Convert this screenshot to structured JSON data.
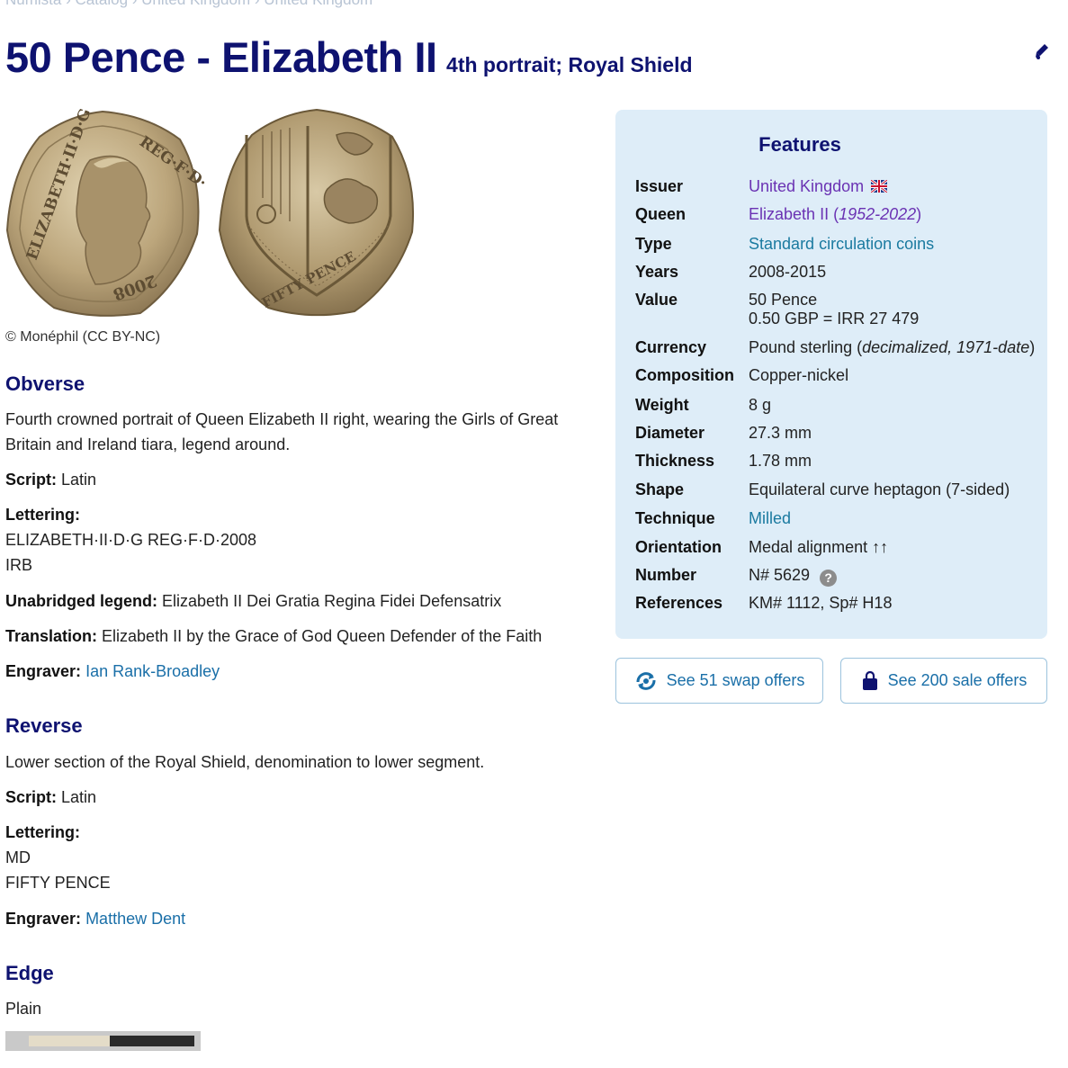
{
  "breadcrumb": "Numista › Catalog › United Kingdom › United Kingdom",
  "header": {
    "title": "50 Pence - Elizabeth II",
    "subtitle": "4th portrait; Royal Shield"
  },
  "coins": {
    "obverse_legend_left": "ELIZABETH·II·D·G",
    "obverse_legend_right": "REG·F·D·",
    "obverse_year": "2008",
    "reverse_legend": "FIFTY PENCE",
    "credit": "© Monéphil (CC BY-NC)"
  },
  "obverse": {
    "title": "Obverse",
    "description": "Fourth crowned portrait of Queen Elizabeth II right, wearing the Girls of Great Britain and Ireland tiara, legend around.",
    "script_label": "Script:",
    "script_value": "Latin",
    "lettering_label": "Lettering:",
    "lettering_line1": "ELIZABETH·II·D·G REG·F·D·2008",
    "lettering_line2": "IRB",
    "legend_label": "Unabridged legend:",
    "legend_value": "Elizabeth II Dei Gratia Regina Fidei Defensatrix",
    "translation_label": "Translation:",
    "translation_value": "Elizabeth II by the Grace of God Queen Defender of the Faith",
    "engraver_label": "Engraver:",
    "engraver_value": "Ian Rank-Broadley"
  },
  "reverse": {
    "title": "Reverse",
    "description": "Lower section of the Royal Shield, denomination to lower segment.",
    "script_label": "Script:",
    "script_value": "Latin",
    "lettering_label": "Lettering:",
    "lettering_line1": "MD",
    "lettering_line2": "FIFTY PENCE",
    "engraver_label": "Engraver:",
    "engraver_value": "Matthew Dent"
  },
  "edge": {
    "title": "Edge",
    "value": "Plain"
  },
  "features": {
    "title": "Features",
    "issuer_label": "Issuer",
    "issuer_value": "United Kingdom",
    "queen_label": "Queen",
    "queen_value": "Elizabeth II (",
    "queen_years": "1952-2022",
    "queen_close": ")",
    "type_label": "Type",
    "type_value": "Standard circulation coins",
    "years_label": "Years",
    "years_value": "2008-2015",
    "value_label": "Value",
    "value_line1": "50 Pence",
    "value_line2": "0.50 GBP = IRR 27 479",
    "currency_label": "Currency",
    "currency_value": "Pound sterling (",
    "currency_note": "decimalized, 1971-date",
    "currency_close": ")",
    "composition_label": "Composition",
    "composition_value": "Copper-nickel",
    "weight_label": "Weight",
    "weight_value": "8 g",
    "diameter_label": "Diameter",
    "diameter_value": "27.3 mm",
    "thickness_label": "Thickness",
    "thickness_value": "1.78 mm",
    "shape_label": "Shape",
    "shape_value": "Equilateral curve heptagon (7-sided)",
    "technique_label": "Technique",
    "technique_value": "Milled",
    "orientation_label": "Orientation",
    "orientation_value": "Medal alignment ↑↑",
    "number_label": "Number",
    "number_value": "N# 5629",
    "references_label": "References",
    "references_value": "KM# 1112, Sp# H18"
  },
  "offers": {
    "swap_label": "See 51 swap offers",
    "sale_label": "See 200 sale offers"
  },
  "colors": {
    "title": "#0e1270",
    "link": "#1a6fa8",
    "purple_link": "#6a32b3",
    "features_bg": "#deedf8"
  }
}
